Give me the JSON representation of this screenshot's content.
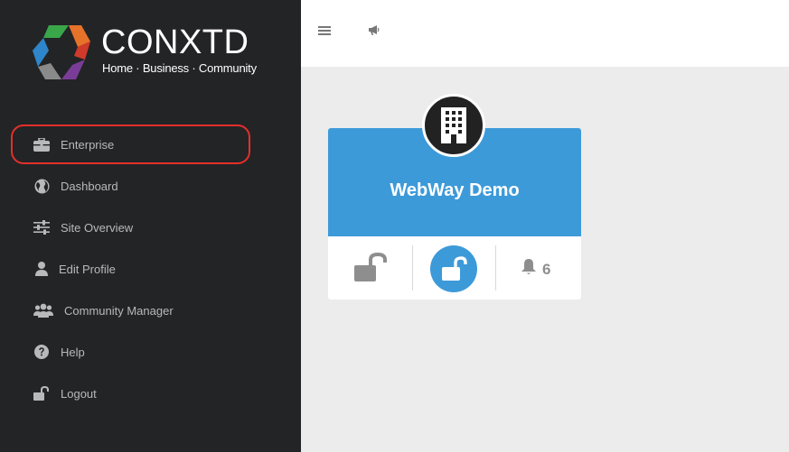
{
  "brand": {
    "name": "CONXTD",
    "tagline": "Home · Business · Community",
    "colors": {
      "green": "#3aa64a",
      "blue": "#2f85c9",
      "orange": "#e7732a",
      "red": "#cf3a2a",
      "purple": "#7a3d97",
      "grey": "#8a8a8a"
    }
  },
  "sidebar": {
    "items": [
      {
        "label": "Enterprise",
        "icon": "briefcase-icon",
        "highlighted": true
      },
      {
        "label": "Dashboard",
        "icon": "globe-icon"
      },
      {
        "label": "Site Overview",
        "icon": "sliders-icon"
      },
      {
        "label": "Edit Profile",
        "icon": "user-icon"
      },
      {
        "label": "Community Manager",
        "icon": "users-icon"
      },
      {
        "label": "Help",
        "icon": "question-icon"
      },
      {
        "label": "Logout",
        "icon": "unlock-icon"
      }
    ],
    "highlight_color": "#e3302a"
  },
  "topbar": {
    "icons": [
      "menu-icon",
      "bullhorn-icon"
    ]
  },
  "site_card": {
    "title": "WebWay Demo",
    "icon": "building-icon",
    "header_color": "#3d9ad9",
    "actions": [
      "unlock-grey-icon",
      "unlock-blue-icon",
      "bell-icon"
    ],
    "alert_count": "6"
  }
}
